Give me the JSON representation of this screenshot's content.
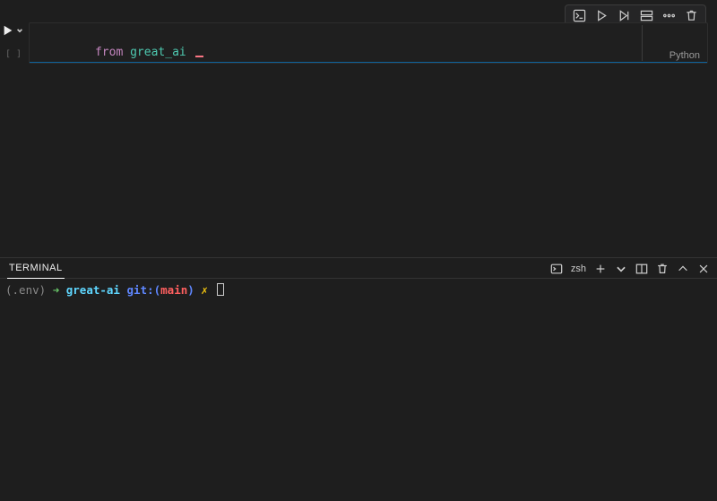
{
  "cell_toolbar": {
    "icons": [
      "python-env",
      "run",
      "run-below",
      "split",
      "more",
      "trash"
    ]
  },
  "run_button": {
    "name": "play"
  },
  "execution_count": "[ ]",
  "code": {
    "keyword_from": "from",
    "module": "great_ai"
  },
  "cell": {
    "language_label": "Python"
  },
  "panel": {
    "tab_label": "TERMINAL"
  },
  "panel_actions": {
    "shell_label": "zsh"
  },
  "terminal_prompt": {
    "env": "(.env)",
    "arrow": "➜",
    "dir": "great-ai",
    "git_prefix": "git:",
    "git_open": "(",
    "branch": "main",
    "git_close": ")",
    "dirty": "✗"
  }
}
